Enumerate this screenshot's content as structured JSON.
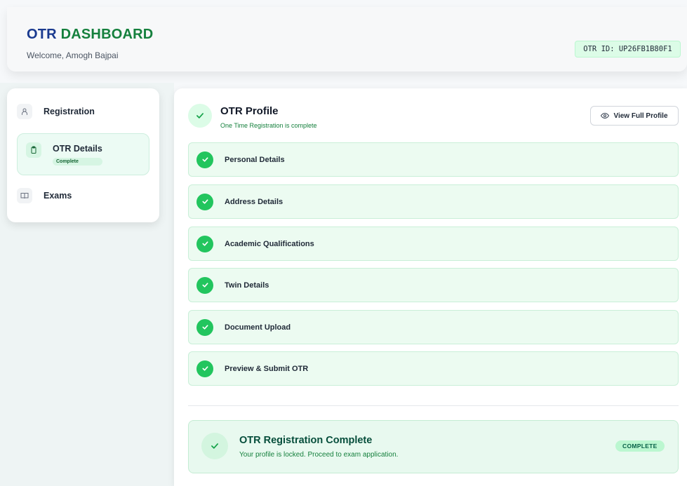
{
  "header": {
    "title_part1": "OTR",
    "title_part2": "DASHBOARD",
    "welcome": "Welcome, Amogh Bajpai",
    "otr_id": "OTR ID: UP26FB1B80F1"
  },
  "sidebar": {
    "items": [
      {
        "label": "Registration",
        "icon": "user-icon",
        "active": false
      },
      {
        "label": "OTR Details",
        "icon": "clipboard-icon",
        "active": true,
        "badge": "Complete"
      },
      {
        "label": "Exams",
        "icon": "book-icon",
        "active": false
      }
    ]
  },
  "profile": {
    "title": "OTR Profile",
    "subtitle": "One Time Registration is complete",
    "view_button": "View Full Profile"
  },
  "steps": [
    {
      "label": "Personal Details",
      "status": "complete"
    },
    {
      "label": "Address Details",
      "status": "complete"
    },
    {
      "label": "Academic Qualifications",
      "status": "complete"
    },
    {
      "label": "Twin Details",
      "status": "complete"
    },
    {
      "label": "Document Upload",
      "status": "complete"
    },
    {
      "label": "Preview & Submit OTR",
      "status": "complete"
    }
  ],
  "completion": {
    "title": "OTR Registration Complete",
    "subtitle": "Your profile is locked. Proceed to exam application.",
    "badge": "COMPLETE"
  },
  "colors": {
    "brand_blue": "#1a3a8f",
    "brand_green": "#15803d",
    "success": "#22c55e",
    "step_bg": "#ecfbf1"
  }
}
